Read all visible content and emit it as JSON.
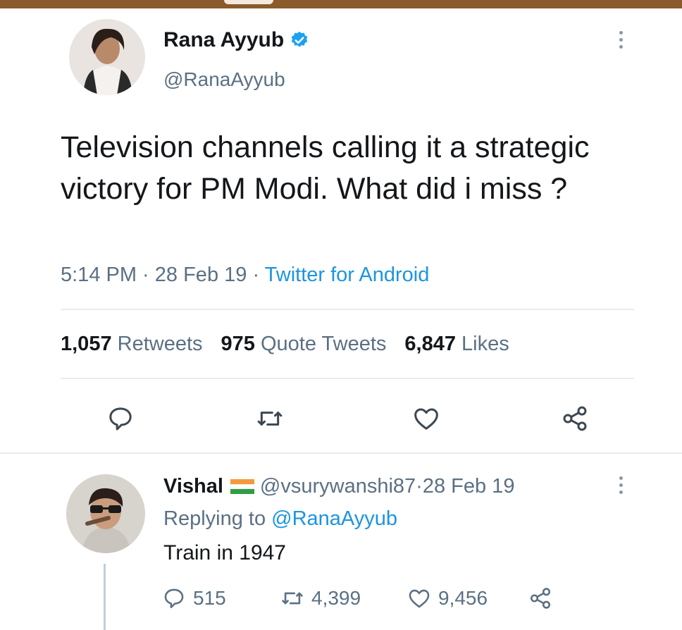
{
  "tweet": {
    "author_name": "Rana Ayyub",
    "author_handle": "@RanaAyyub",
    "text": "Television channels calling it a strategic victory for PM Modi. What did i miss ?",
    "time": "5:14 PM",
    "sep1": " · ",
    "date": "28 Feb 19",
    "sep2": " · ",
    "source": "Twitter for Android",
    "stats": {
      "retweets_count": "1,057",
      "retweets_label": "Retweets",
      "quotes_count": "975",
      "quotes_label": "Quote Tweets",
      "likes_count": "6,847",
      "likes_label": "Likes"
    }
  },
  "reply": {
    "author_name": "Vishal",
    "author_handle": "@vsurywanshi87",
    "sep": " · ",
    "date": "28 Feb 19",
    "replying_prefix": "Replying to ",
    "replying_to": "@RanaAyyub",
    "text": "Train in 1947",
    "replies_count": "515",
    "retweets_count": "4,399",
    "likes_count": "9,456"
  },
  "icons": {
    "verified": "verified-badge-icon",
    "more": "more-vertical-icon",
    "reply": "reply-icon",
    "retweet": "retweet-icon",
    "like": "heart-icon",
    "share": "share-icon",
    "flag": "india-flag-icon"
  },
  "colors": {
    "accent": "#1b95e0",
    "muted": "#5b7083",
    "text": "#14171a",
    "divider": "#e6ecf0",
    "topbar": "#8a5a2b"
  }
}
